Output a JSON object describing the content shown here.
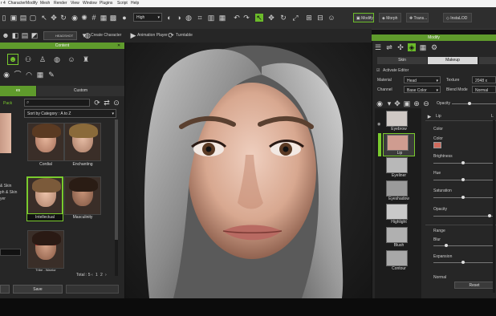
{
  "app_title_fragment": "r 4",
  "menu": [
    "Character",
    "Modify",
    "Mesh",
    "Render",
    "View",
    "Window",
    "Plugins",
    "Script",
    "Help"
  ],
  "toolbar": {
    "quality_select": "High",
    "modify_label": "Modify",
    "morph_label": "Morph",
    "transform_label": "Trans...",
    "instalod_label": "InstaLOD"
  },
  "bar2": {
    "headshot_label": "HEADSHOT",
    "create_character": "Create Character",
    "animation_player": "Animation Player",
    "turntable": "Turntable"
  },
  "content": {
    "title": "Content",
    "tabs": [
      "es",
      "Custom"
    ],
    "pack_label": "Pack",
    "sort_select": "Sort by Category : A to Z",
    "items": [
      {
        "label": "Cordial"
      },
      {
        "label": "Enchanting"
      },
      {
        "label": "Intellectual"
      },
      {
        "label": "Masculinity"
      },
      {
        "label": "Tribe - Warrior"
      }
    ],
    "side_labels": [
      "& Skin",
      "ph & Skin",
      "yer"
    ],
    "total_label": "Total : 5",
    "pages": [
      "1",
      "2"
    ],
    "bottom_buttons": [
      "Save"
    ]
  },
  "modify": {
    "title": "Modify",
    "tabs": [
      "Skin",
      "Makeup"
    ],
    "activate_editor": "Activate Editor",
    "material_label": "Material",
    "material_value": "Head",
    "texture_label": "Texture",
    "texture_value": "2048 x 2048",
    "channel_label": "Channel",
    "channel_value": "Base Color",
    "blend_mode_label": "Blend Mode",
    "blend_mode_value": "Normal",
    "opacity_label": "Opacity",
    "layers": [
      "Eyebrow",
      "Lip",
      "Eyeliner",
      "Eyeshadow",
      "Highlight",
      "Blush",
      "Contour"
    ],
    "active_layer": "Lip",
    "color_section": "Color",
    "color_label": "Color",
    "color_swatch": "#d06a5c",
    "brightness_label": "Brightness",
    "hue_label": "Hue",
    "saturation_label": "Saturation",
    "opacity2_label": "Opacity",
    "range_section": "Range",
    "blur_label": "Blur",
    "expansion_label": "Expansion",
    "normal_label": "Normal",
    "reset_button": "Reset",
    "lip_header": "Lip",
    "lip_header_right": "L"
  },
  "colors": {
    "accent_green": "#5f9b2c",
    "active_green": "#7acb2e"
  }
}
